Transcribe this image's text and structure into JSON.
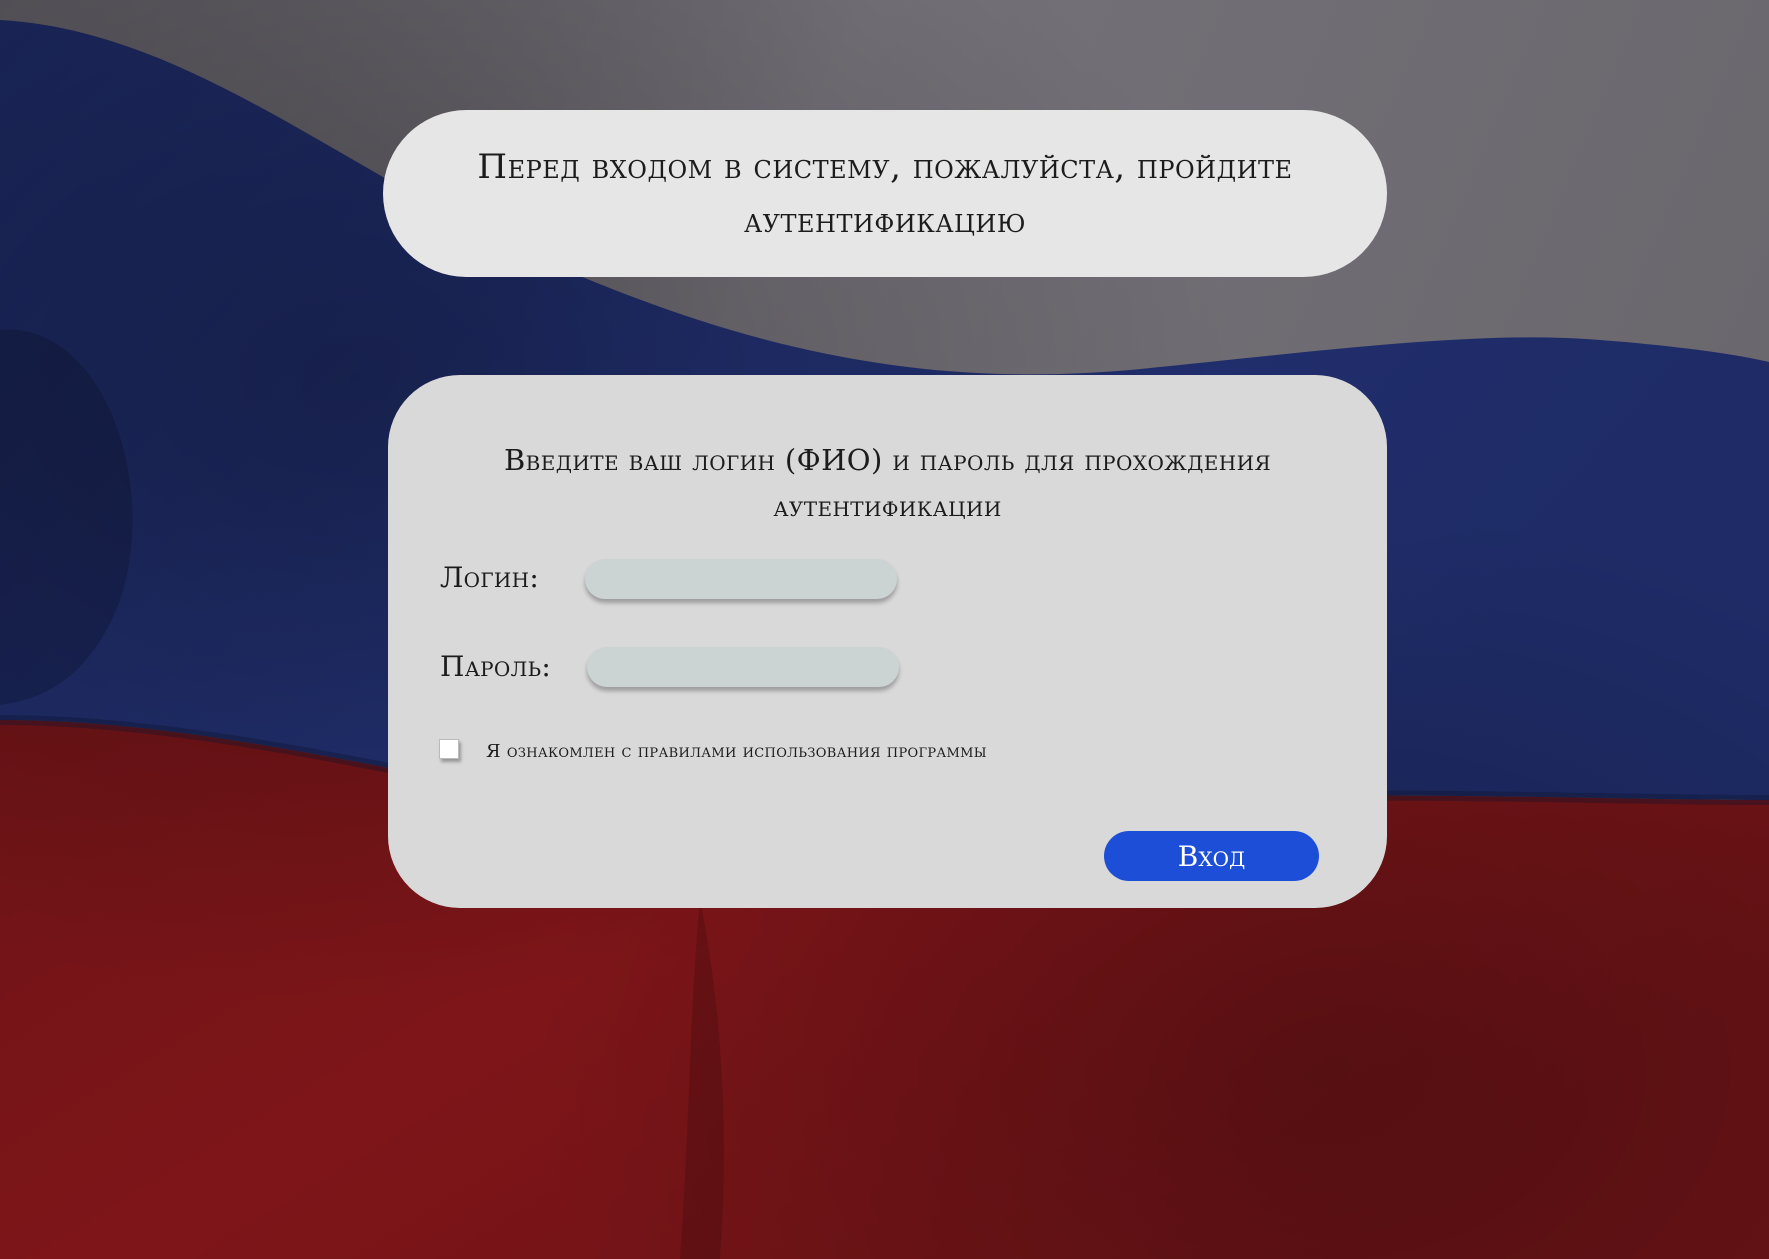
{
  "header": {
    "title": "Перед входом в систему, пожалуйста, пройдите аутентификацию"
  },
  "form": {
    "heading": "Введите ваш логин (ФИО) и пароль для прохождения аутентификации",
    "login": {
      "label": "Логин:",
      "value": "",
      "placeholder": ""
    },
    "password": {
      "label": "Пароль:",
      "value": "",
      "placeholder": ""
    },
    "agreement": {
      "label": "Я ознакомлен с правилами использования программы",
      "checked": false
    },
    "submit_label": "Вход"
  },
  "background": {
    "image": "russian-flag",
    "colors": {
      "white_stripe": "#6f6c72",
      "blue_stripe": "#1f2c66",
      "red_stripe": "#7a1519"
    }
  },
  "colors": {
    "header_card": "#e6e6e6",
    "form_card": "#d9d9d9",
    "input_fill": "#ccd3d3",
    "button_accent": "#1d4ed8",
    "button_text": "#ffffff"
  }
}
